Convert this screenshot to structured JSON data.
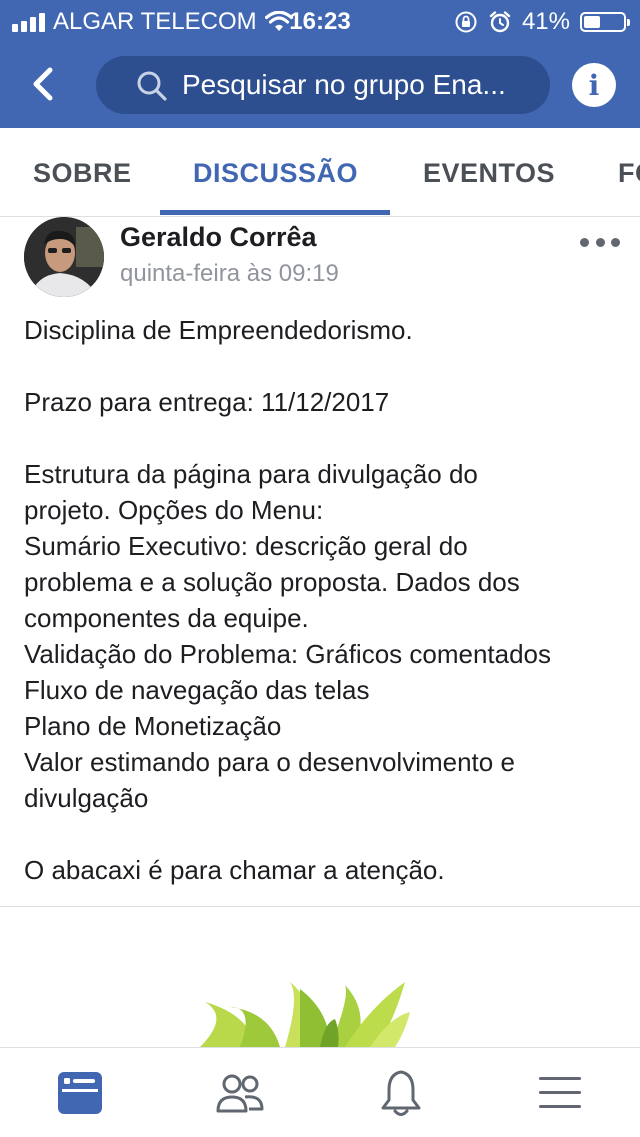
{
  "status_bar": {
    "carrier": "ALGAR TELECOM",
    "time": "16:23",
    "battery_text": "41%",
    "battery_level": 0.41
  },
  "nav": {
    "search_placeholder": "Pesquisar no grupo Ena..."
  },
  "tabs": [
    {
      "label": "SOBRE",
      "active": false
    },
    {
      "label": "DISCUSSÃO",
      "active": true
    },
    {
      "label": "EVENTOS",
      "active": false
    },
    {
      "label": "FO",
      "active": false
    }
  ],
  "post": {
    "author": "Geraldo Corrêa",
    "timestamp": "quinta-feira às 09:19",
    "lines": [
      "Disciplina de Empreendedorismo.",
      "",
      "Prazo para entrega: 11/12/2017",
      "",
      "Estrutura da página para divulgação do",
      "projeto. Opções do Menu:",
      "Sumário Executivo: descrição geral do",
      "problema e a solução proposta. Dados dos",
      "componentes da equipe.",
      "Validação do Problema: Gráficos comentados",
      "Fluxo de navegação das telas",
      "Plano de Monetização",
      "Valor estimando para o desenvolvimento e",
      "divulgação",
      "",
      "O abacaxi é para chamar a atenção."
    ]
  },
  "colors": {
    "brand": "#4267b2",
    "search_bg": "#2d4f8f",
    "text": "#1c1e21",
    "secondary_text": "#90949c",
    "tab_inactive": "#4b4f56"
  },
  "icons": {
    "back": "chevron-left-icon",
    "search": "search-icon",
    "info": "info-icon",
    "more": "more-options-icon",
    "bottom_nav": [
      "news-feed-icon",
      "groups-icon",
      "notifications-bell-icon",
      "menu-icon"
    ]
  }
}
